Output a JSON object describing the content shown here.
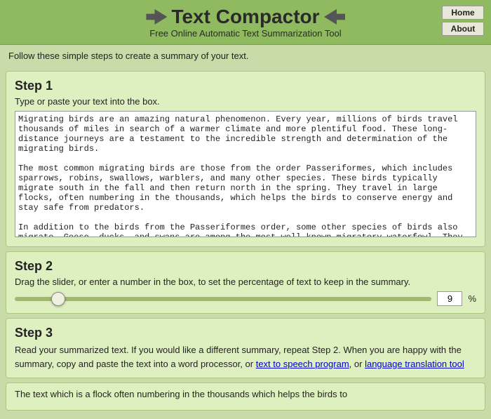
{
  "header": {
    "title": "Text Compactor",
    "subtitle": "Free Online Automatic Text Summarization Tool",
    "nav": {
      "home_label": "Home",
      "about_label": "About"
    }
  },
  "intro": {
    "text": "Follow these simple steps to create a summary of your text."
  },
  "step1": {
    "title": "Step 1",
    "instruction": "Type or paste your text into the box.",
    "textarea_value": "Migrating birds are an amazing natural phenomenon. Every year, millions of birds travel thousands of miles in search of a warmer climate and more plentiful food. These long-distance journeys are a testament to the incredible strength and determination of the migrating birds.\n\nThe most common migrating birds are those from the order Passeriformes, which includes sparrows, robins, swallows, warblers, and many other species. These birds typically migrate south in the fall and then return north in the spring. They travel in large flocks, often numbering in the thousands, which helps the birds to conserve energy and stay safe from predators.\n\nIn addition to the birds from the Passeriformes order, some other species of birds also migrate. Geese, ducks, and swans are among the most well-known migratory waterfowl. They fly in large V-shaped formations, which help them to utilize the air currents more efficiently. Other birds that migrate include raptors such as eagles and hawks, as well as seabirds and shorebirds.\n\nThe exact motivations behind bird migration still remain a mystery. In some cases, the birds are"
  },
  "step2": {
    "title": "Step 2",
    "instruction": "Drag the slider, or enter a number in the box, to set the percentage of text to keep in the summary.",
    "slider_value": 9,
    "percent_symbol": "%"
  },
  "step3": {
    "title": "Step 3",
    "instruction_part1": "Read your summarized text. If you would like a different summary, repeat Step 2. When you are happy with the summary, copy and paste the text into a word processor, or ",
    "link1_text": "text to speech program",
    "link1_href": "#",
    "instruction_part2": ", or ",
    "link2_text": "language translation tool",
    "link2_href": "#"
  },
  "output": {
    "text": "The text which is a flock often numbering in the thousands which helps the birds to"
  }
}
